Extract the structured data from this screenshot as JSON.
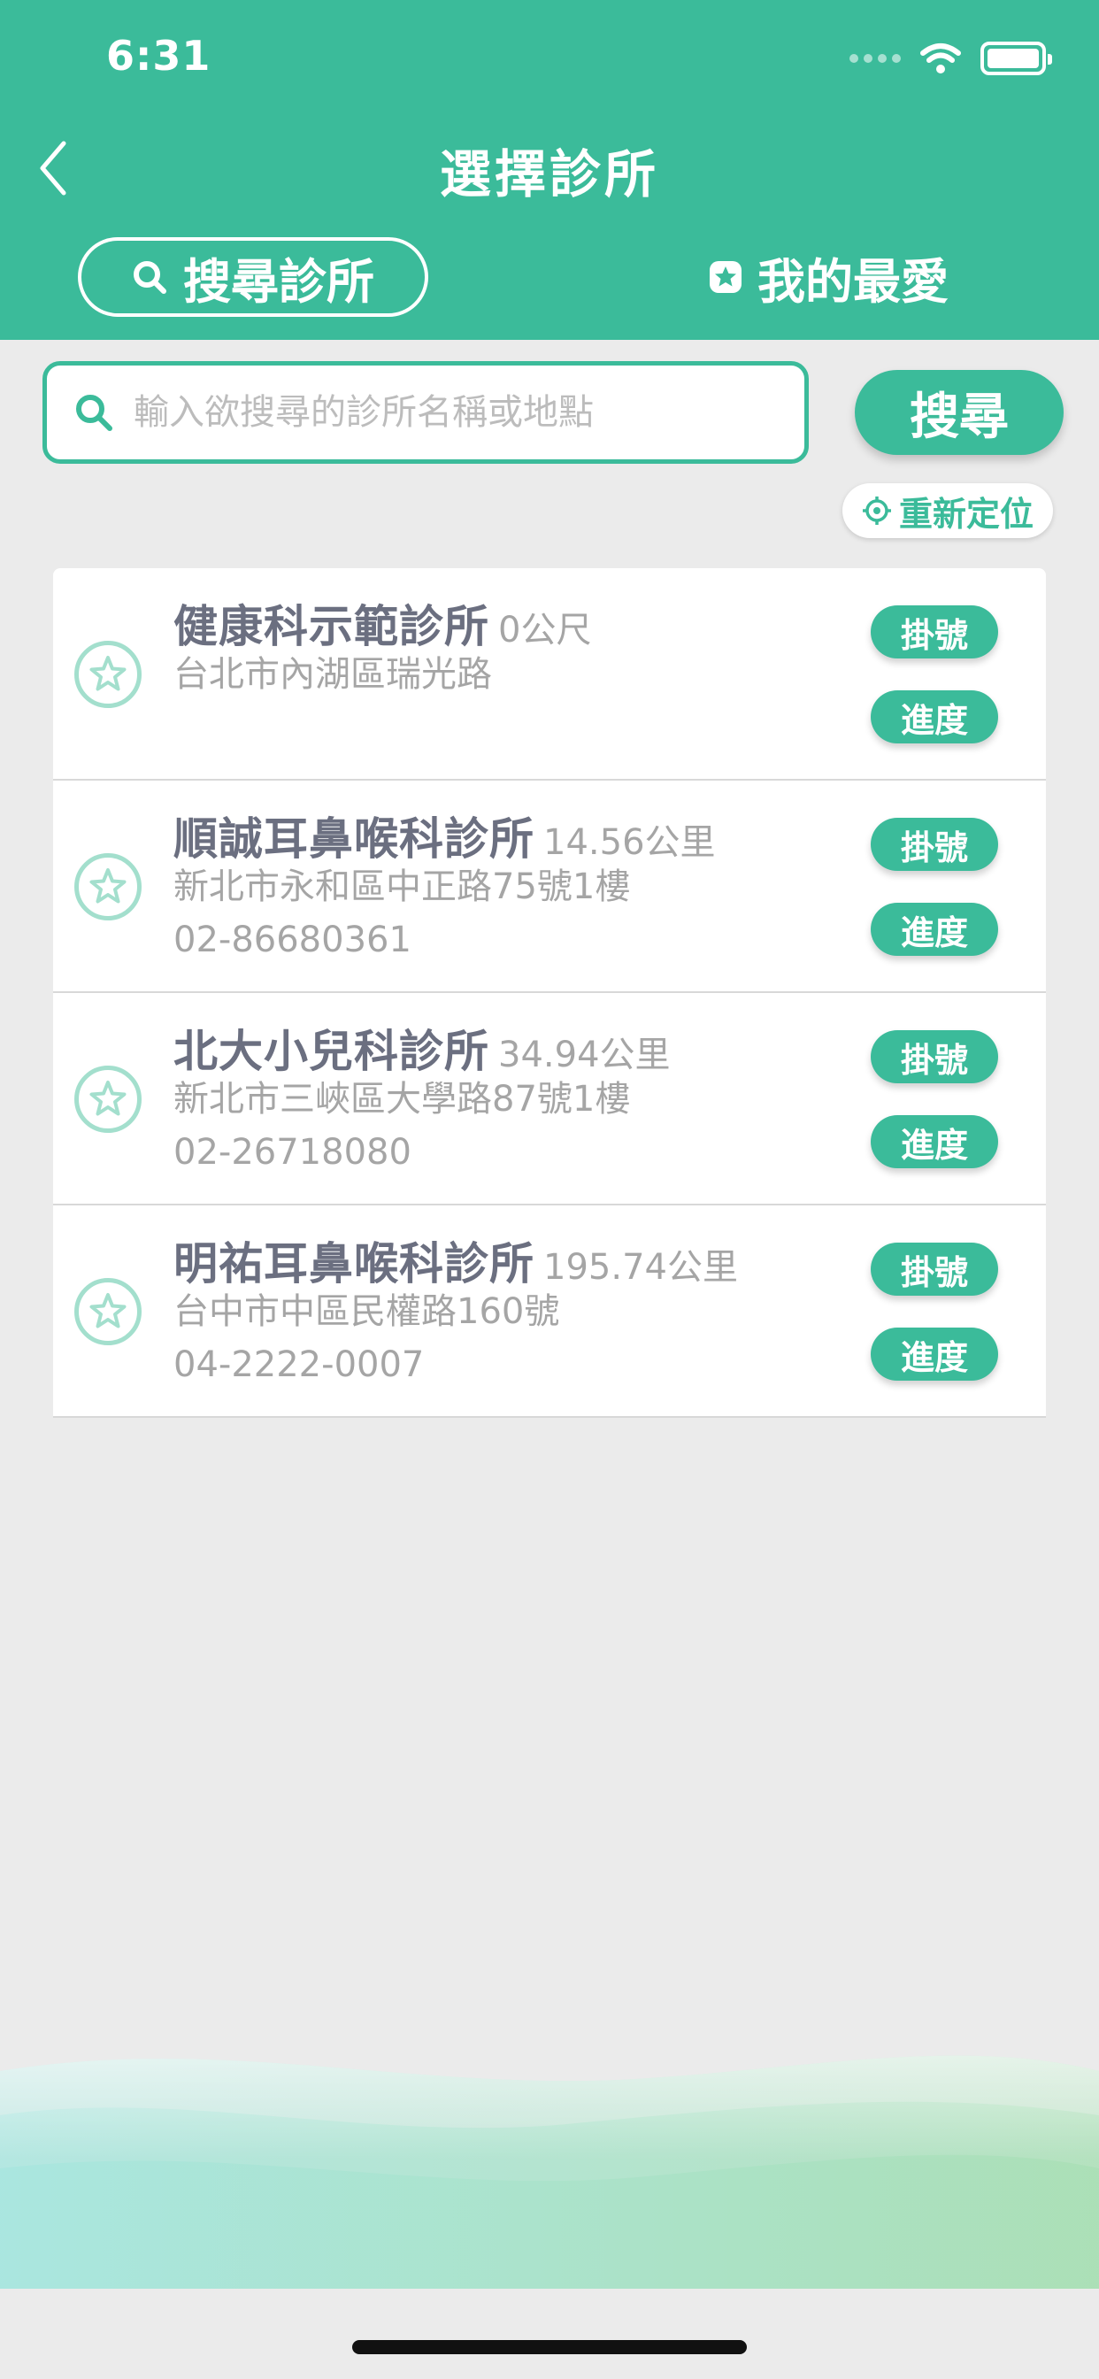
{
  "status_bar": {
    "time": "6:31"
  },
  "header": {
    "title": "選擇診所",
    "tab_search": "搜尋診所",
    "tab_favorites": "我的最愛"
  },
  "search": {
    "placeholder": "輸入欲搜尋的診所名稱或地點",
    "value": "",
    "button_label": "搜尋",
    "relocate_label": "重新定位"
  },
  "clinics": [
    {
      "name": "健康科示範診所",
      "distance": "0公尺",
      "address": "台北市內湖區瑞光路",
      "phone": "",
      "register_label": "掛號",
      "progress_label": "進度"
    },
    {
      "name": "順誠耳鼻喉科診所",
      "distance": "14.56公里",
      "address": "新北市永和區中正路75號1樓",
      "phone": "02-86680361",
      "register_label": "掛號",
      "progress_label": "進度"
    },
    {
      "name": "北大小兒科診所",
      "distance": "34.94公里",
      "address": "新北市三峽區大學路87號1樓",
      "phone": "02-26718080",
      "register_label": "掛號",
      "progress_label": "進度"
    },
    {
      "name": "明祐耳鼻喉科診所",
      "distance": "195.74公里",
      "address": "台中市中區民權路160號",
      "phone": "04-2222-0007",
      "register_label": "掛號",
      "progress_label": "進度"
    }
  ],
  "colors": {
    "primary": "#3bbb9a",
    "background": "#ebebeb",
    "star_outline": "#a3dfcd",
    "name_text": "#6b6f80",
    "secondary_text": "#a5a5a5"
  },
  "icons": {
    "back": "chevron-left-icon",
    "search": "search-icon",
    "favorite_tab": "star-badge-icon",
    "relocate": "crosshair-icon",
    "clinic_favorite": "star-outline-icon"
  }
}
